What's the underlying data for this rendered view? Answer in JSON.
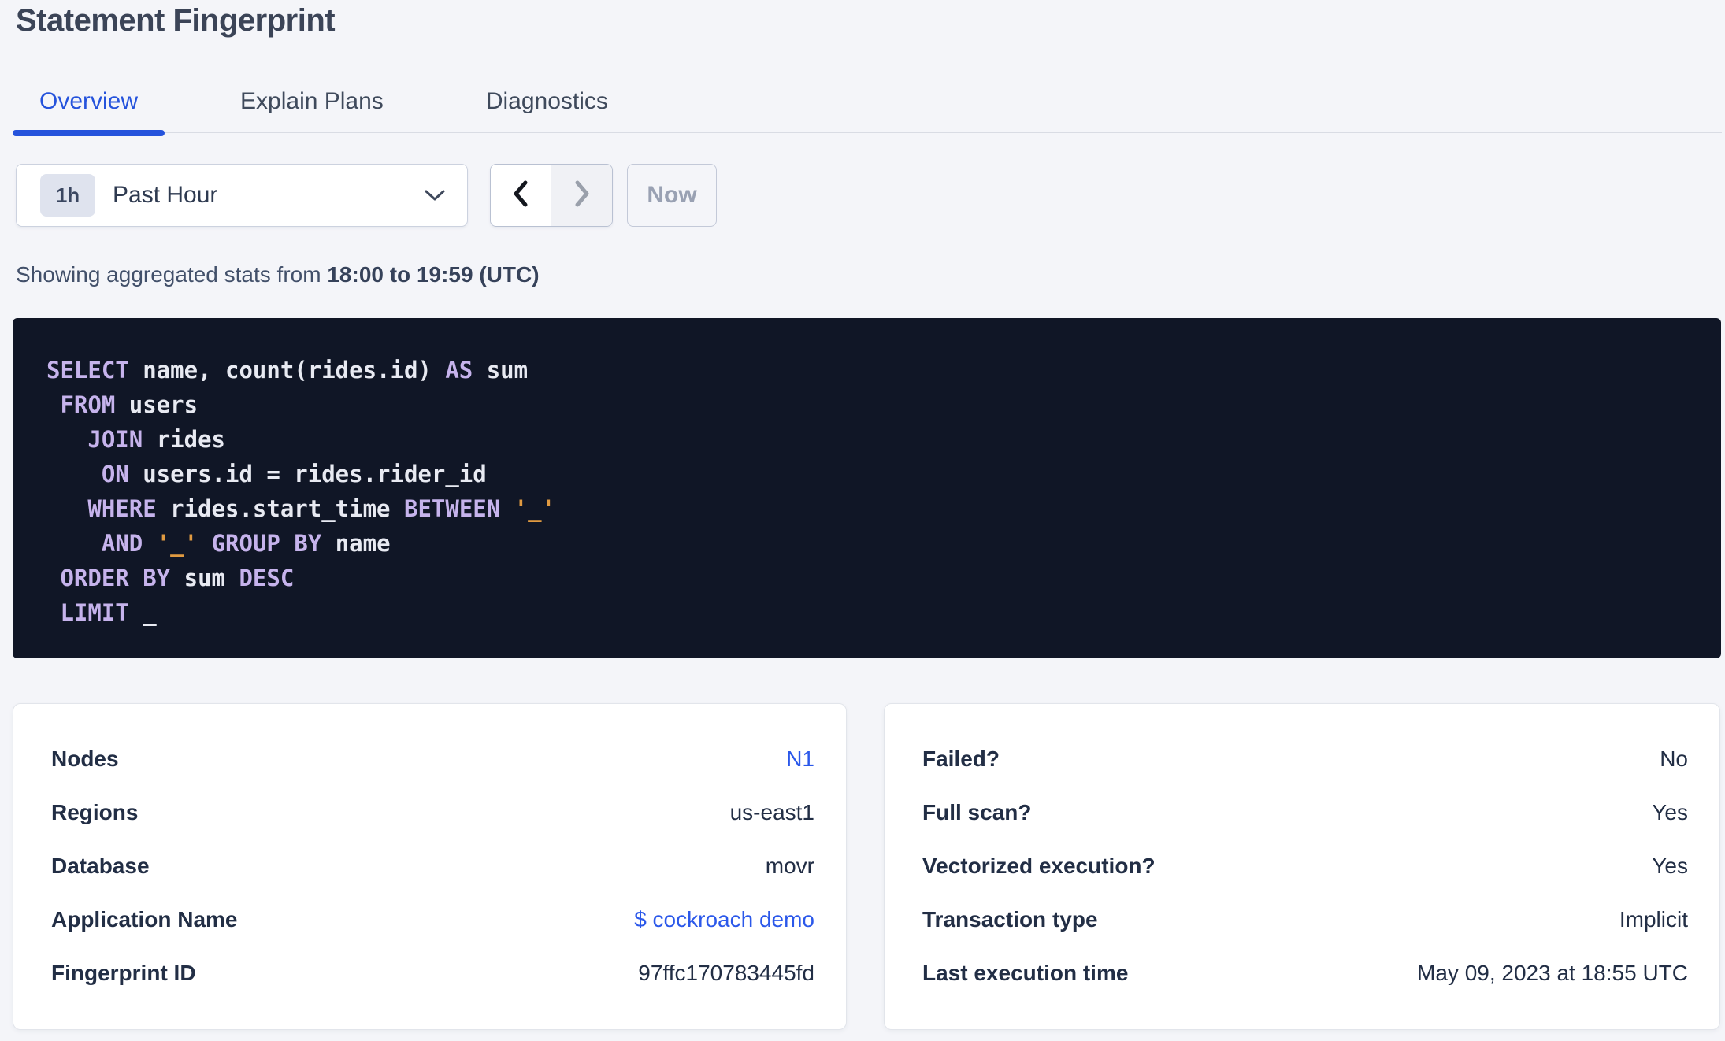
{
  "page": {
    "title": "Statement Fingerprint"
  },
  "tabs": [
    {
      "label": "Overview",
      "active": true
    },
    {
      "label": "Explain Plans",
      "active": false
    },
    {
      "label": "Diagnostics",
      "active": false
    }
  ],
  "time_picker": {
    "interval_badge": "1h",
    "interval_label": "Past Hour",
    "dropdown_icon": "chevron-down-icon",
    "prev_icon": "chevron-left-icon",
    "next_icon": "chevron-right-icon",
    "now_label": "Now"
  },
  "stats_line": {
    "prefix": "Showing aggregated stats from ",
    "range": "18:00 to 19:59 (UTC)"
  },
  "sql": {
    "lines": [
      [
        [
          "kw",
          "SELECT"
        ],
        [
          "pl",
          " name, count(rides.id) "
        ],
        [
          "kw",
          "AS"
        ],
        [
          "pl",
          " sum"
        ]
      ],
      [
        [
          "pl",
          " "
        ],
        [
          "kw",
          "FROM"
        ],
        [
          "pl",
          " users"
        ]
      ],
      [
        [
          "pl",
          "   "
        ],
        [
          "kw",
          "JOIN"
        ],
        [
          "pl",
          " rides"
        ]
      ],
      [
        [
          "pl",
          "    "
        ],
        [
          "kw",
          "ON"
        ],
        [
          "pl",
          " users.id = rides.rider_id"
        ]
      ],
      [
        [
          "pl",
          "   "
        ],
        [
          "kw",
          "WHERE"
        ],
        [
          "pl",
          " rides.start_time "
        ],
        [
          "kw",
          "BETWEEN"
        ],
        [
          "pl",
          " "
        ],
        [
          "str",
          "'_'"
        ]
      ],
      [
        [
          "pl",
          "    "
        ],
        [
          "kw",
          "AND"
        ],
        [
          "pl",
          " "
        ],
        [
          "str",
          "'_'"
        ],
        [
          "pl",
          " "
        ],
        [
          "kw",
          "GROUP BY"
        ],
        [
          "pl",
          " name"
        ]
      ],
      [
        [
          "pl",
          " "
        ],
        [
          "kw",
          "ORDER BY"
        ],
        [
          "pl",
          " sum "
        ],
        [
          "kw",
          "DESC"
        ]
      ],
      [
        [
          "pl",
          " "
        ],
        [
          "kw",
          "LIMIT"
        ],
        [
          "pl",
          " _"
        ]
      ]
    ]
  },
  "cards": {
    "left": {
      "rows": [
        {
          "label": "Nodes",
          "value": "N1",
          "link": true
        },
        {
          "label": "Regions",
          "value": "us-east1",
          "link": false
        },
        {
          "label": "Database",
          "value": "movr",
          "link": false
        },
        {
          "label": "Application Name",
          "value": "$ cockroach demo",
          "link": true
        },
        {
          "label": "Fingerprint ID",
          "value": "97ffc170783445fd",
          "link": false
        }
      ]
    },
    "right": {
      "rows": [
        {
          "label": "Failed?",
          "value": "No",
          "link": false
        },
        {
          "label": "Full scan?",
          "value": "Yes",
          "link": false
        },
        {
          "label": "Vectorized execution?",
          "value": "Yes",
          "link": false
        },
        {
          "label": "Transaction type",
          "value": "Implicit",
          "link": false
        },
        {
          "label": "Last execution time",
          "value": "May 09, 2023 at 18:55 UTC",
          "link": false
        }
      ]
    }
  },
  "colors": {
    "page_background": "#f4f5f9",
    "accent_blue": "#2553dc",
    "link_blue": "#2b58ea",
    "sql_background": "#101626",
    "sql_keyword": "#c6b3ec",
    "sql_text": "#e8eaf2",
    "sql_literal": "#e09a41",
    "title_text": "#3b4457"
  }
}
